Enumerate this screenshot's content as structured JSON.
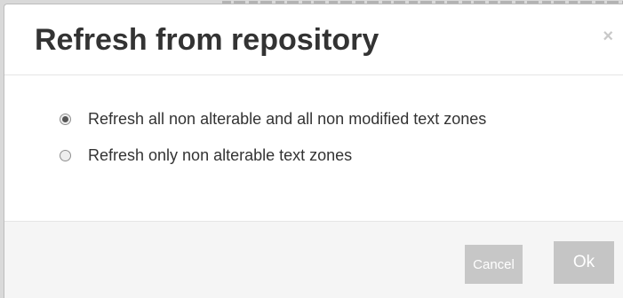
{
  "dialog": {
    "title": "Refresh from repository",
    "close_label": "×"
  },
  "options": [
    {
      "label": "Refresh all non alterable and all non modified text zones",
      "checked": true
    },
    {
      "label": "Refresh only non alterable text zones",
      "checked": false
    }
  ],
  "footer": {
    "cancel_label": "Cancel",
    "ok_label": "Ok"
  }
}
